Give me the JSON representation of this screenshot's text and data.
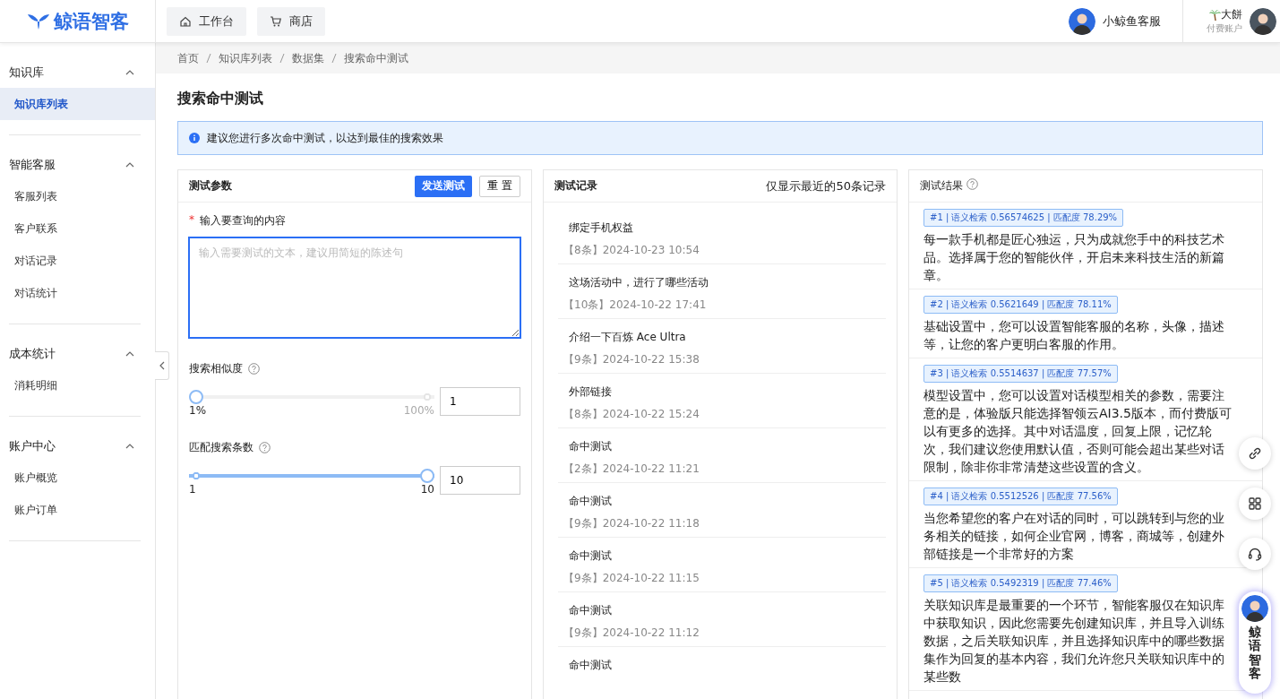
{
  "header": {
    "logo": "鲸语智客",
    "nav": [
      {
        "label": "工作台"
      },
      {
        "label": "商店"
      }
    ],
    "agent": {
      "name": "小鲸鱼客服"
    },
    "user": {
      "name": "大餅",
      "plan": "付费账户"
    }
  },
  "sidebar": {
    "groups": [
      {
        "label": "知识库",
        "expanded": true,
        "items": [
          {
            "label": "知识库列表",
            "selected": true
          }
        ]
      },
      {
        "label": "智能客服",
        "expanded": true,
        "items": [
          {
            "label": "客服列表",
            "selected": false
          },
          {
            "label": "客户联系",
            "selected": false
          },
          {
            "label": "对话记录",
            "selected": false
          },
          {
            "label": "对话统计",
            "selected": false
          }
        ]
      },
      {
        "label": "成本统计",
        "expanded": true,
        "items": [
          {
            "label": "消耗明细",
            "selected": false
          }
        ]
      },
      {
        "label": "账户中心",
        "expanded": true,
        "items": [
          {
            "label": "账户概览",
            "selected": false
          },
          {
            "label": "账户订单",
            "selected": false
          }
        ]
      }
    ]
  },
  "breadcrumb": [
    "首页",
    "知识库列表",
    "数据集",
    "搜索命中测试"
  ],
  "page_title": "搜索命中测试",
  "alert": "建议您进行多次命中测试，以达到最佳的搜索效果",
  "params": {
    "title": "测试参数",
    "send_button": "发送测试",
    "reset_button": "重 置",
    "query": {
      "required_mark": "*",
      "label": "输入要查询的内容",
      "placeholder": "输入需要测试的文本，建议用简短的陈述句",
      "focused": true
    },
    "sliders": [
      {
        "label": "搜索相似度",
        "min_label": "1%",
        "max_label": "100%",
        "level": 0,
        "value": "1"
      },
      {
        "label": "匹配搜索条数",
        "min_label": "1",
        "max_label": "10",
        "level": 1,
        "value": "10"
      }
    ]
  },
  "records": {
    "title": "测试记录",
    "note": "仅显示最近的50条记录",
    "items": [
      {
        "query": "绑定手机权益",
        "meta": "【8条】2024-10-23 10:54"
      },
      {
        "query": "这场活动中，进行了哪些活动",
        "meta": "【10条】2024-10-22 17:41"
      },
      {
        "query": "介绍一下百炼 Ace Ultra",
        "meta": "【9条】2024-10-22 15:38"
      },
      {
        "query": "外部链接",
        "meta": "【8条】2024-10-22 15:24"
      },
      {
        "query": "命中测试",
        "meta": "【2条】2024-10-22 11:21"
      },
      {
        "query": "命中测试",
        "meta": "【9条】2024-10-22 11:18"
      },
      {
        "query": "命中测试",
        "meta": "【9条】2024-10-22 11:15"
      },
      {
        "query": "命中测试",
        "meta": "【9条】2024-10-22 11:12"
      },
      {
        "query": "命中测试"
      }
    ]
  },
  "results": {
    "title": "测试结果",
    "items": [
      {
        "tag": "#1 | 语义检索 0.56574625 | 匹配度 78.29%",
        "text": "每一款手机都是匠心独运，只为成就您手中的科技艺术品。选择属于您的智能伙伴，开启未来科技生活的新篇章。"
      },
      {
        "tag": "#2 | 语义检索 0.5621649 | 匹配度 78.11%",
        "text": "基础设置中，您可以设置智能客服的名称，头像，描述等，让您的客户更明白客服的作用。"
      },
      {
        "tag": "#3 | 语义检索 0.5514637 | 匹配度 77.57%",
        "text": "模型设置中，您可以设置对话模型相关的参数，需要注意的是，体验版只能选择智领云AI3.5版本，而付费版可以有更多的选择。其中对话温度，回复上限，记忆轮次，我们建议您使用默认值，否则可能会超出某些对话限制，除非你非常清楚这些设置的含义。"
      },
      {
        "tag": "#4 | 语义检索 0.5512526 | 匹配度 77.56%",
        "text": "当您希望您的客户在对话的同时，可以跳转到与您的业务相关的链接，如何企业官网，博客，商城等，创建外部链接是一个非常好的方案"
      },
      {
        "tag": "#5 | 语义检索 0.5492319 | 匹配度 77.46%",
        "text": "关联知识库是最重要的一个环节，智能客服仅在知识库中获取知识，因此您需要先创建知识库，并且导入训练数据，之后关联知识库，并且选择知识库中的哪些数据集作为回复的基本内容，我们允许您只关联知识库中的某些数"
      }
    ]
  },
  "assistant": {
    "label": "鲸语智客"
  }
}
